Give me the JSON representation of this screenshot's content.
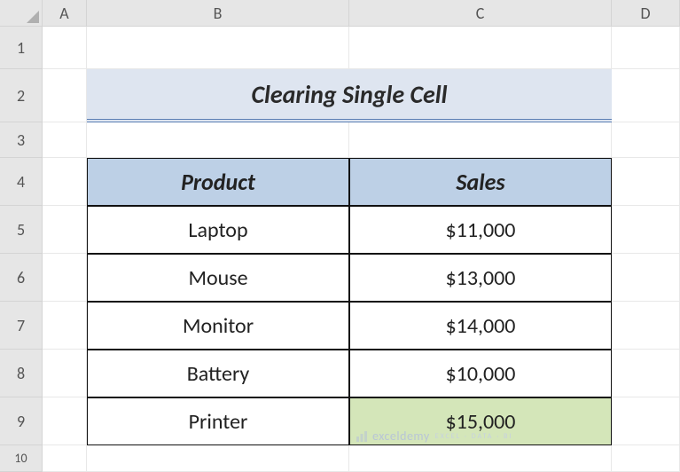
{
  "columns": {
    "A": "A",
    "B": "B",
    "C": "C",
    "D": "D"
  },
  "rows": {
    "r1": "1",
    "r2": "2",
    "r3": "3",
    "r4": "4",
    "r5": "5",
    "r6": "6",
    "r7": "7",
    "r8": "8",
    "r9": "9",
    "r10": "10"
  },
  "title": "Clearing Single Cell",
  "table": {
    "headers": {
      "product": "Product",
      "sales": "Sales"
    },
    "rows": [
      {
        "product": "Laptop",
        "sales": "$11,000"
      },
      {
        "product": "Mouse",
        "sales": "$13,000"
      },
      {
        "product": "Monitor",
        "sales": "$14,000"
      },
      {
        "product": "Battery",
        "sales": "$10,000"
      },
      {
        "product": "Printer",
        "sales": "$15,000"
      }
    ]
  },
  "watermark": {
    "brand": "exceldemy",
    "tag": "EXCEL · DATA · BI"
  }
}
